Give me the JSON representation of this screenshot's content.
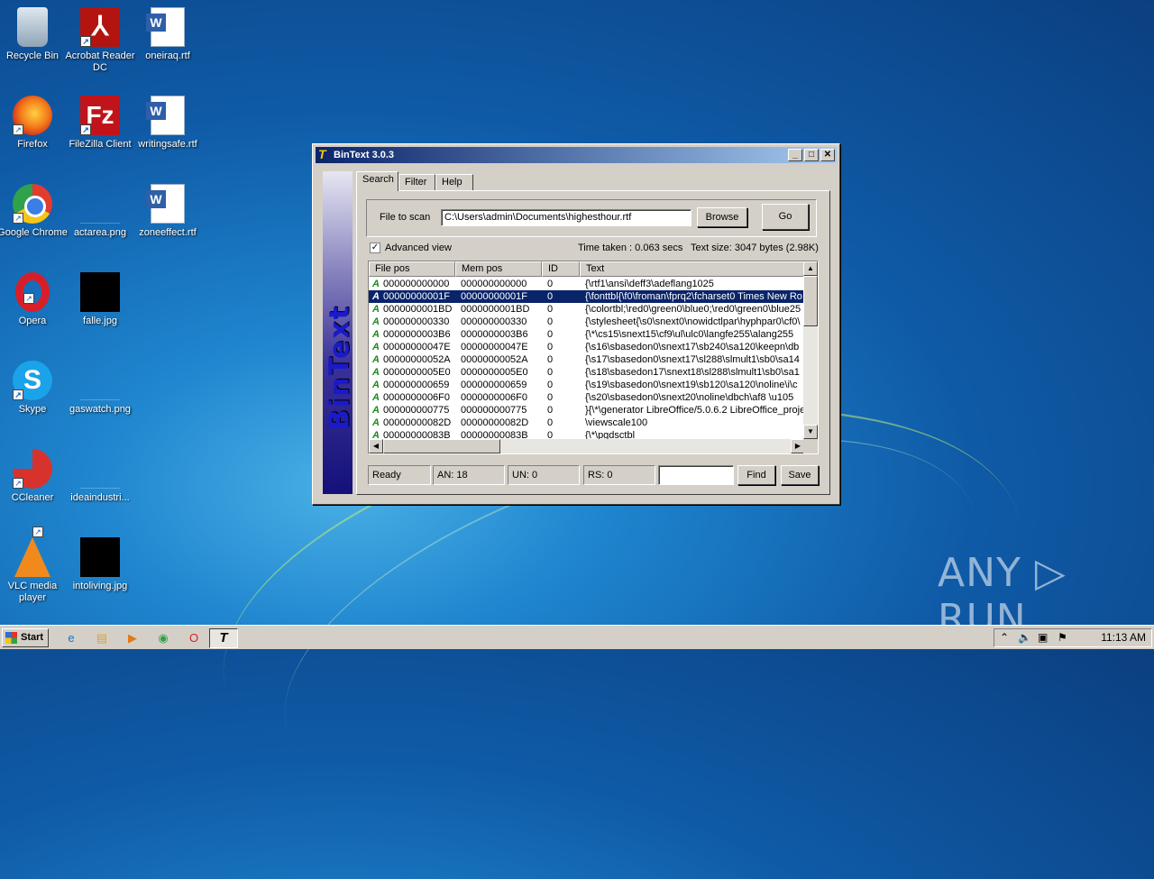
{
  "desktop": {
    "icons": [
      {
        "label": "Recycle Bin",
        "icon": "recycle-bin-icon"
      },
      {
        "label": "Acrobat Reader DC",
        "icon": "acrobat-icon"
      },
      {
        "label": "oneiraq.rtf",
        "icon": "word-document-icon"
      },
      {
        "label": "Firefox",
        "icon": "firefox-icon"
      },
      {
        "label": "FileZilla Client",
        "icon": "filezilla-icon"
      },
      {
        "label": "writingsafe.rtf",
        "icon": "word-document-icon"
      },
      {
        "label": "Google Chrome",
        "icon": "chrome-icon"
      },
      {
        "label": "actarea.png",
        "icon": "image-file-icon"
      },
      {
        "label": "zoneeffect.rtf",
        "icon": "word-document-icon"
      },
      {
        "label": "Opera",
        "icon": "opera-icon"
      },
      {
        "label": "falle.jpg",
        "icon": "image-thumbnail-icon"
      },
      {
        "label": "Skype",
        "icon": "skype-icon"
      },
      {
        "label": "gaswatch.png",
        "icon": "image-file-icon"
      },
      {
        "label": "CCleaner",
        "icon": "ccleaner-icon"
      },
      {
        "label": "ideaindustri...",
        "icon": "image-file-icon"
      },
      {
        "label": "VLC media player",
        "icon": "vlc-icon"
      },
      {
        "label": "intoliving.jpg",
        "icon": "image-thumbnail-icon"
      }
    ]
  },
  "window": {
    "title": "BinText 3.0.3",
    "title_icon_glyph": "T",
    "controls": {
      "minimize": "_",
      "maximize": "□",
      "close": "✕"
    },
    "banner_text": "BinText",
    "tabs": [
      "Search",
      "Filter",
      "Help"
    ],
    "active_tab": "Search",
    "file_label": "File to scan",
    "file_value": "C:\\Users\\admin\\Documents\\highesthour.rtf",
    "browse_label": "Browse",
    "go_label": "Go",
    "advanced_view_label": "Advanced view",
    "advanced_view_checked": "✓",
    "time_taken": "Time taken : 0.063 secs",
    "text_size": "Text size: 3047 bytes (2.98K)",
    "columns": [
      "File pos",
      "Mem pos",
      "ID",
      "Text"
    ],
    "rows": [
      {
        "type": "A",
        "file_pos": "000000000000",
        "mem_pos": "000000000000",
        "id": "0",
        "text": "{\\rtf1\\ansi\\deff3\\adeflang1025"
      },
      {
        "type": "A",
        "file_pos": "00000000001F",
        "mem_pos": "00000000001F",
        "id": "0",
        "text": "{\\fonttbl{\\f0\\froman\\fprq2\\fcharset0 Times New Ro"
      },
      {
        "type": "A",
        "file_pos": "0000000001BD",
        "mem_pos": "0000000001BD",
        "id": "0",
        "text": "{\\colortbl;\\red0\\green0\\blue0;\\red0\\green0\\blue25"
      },
      {
        "type": "A",
        "file_pos": "000000000330",
        "mem_pos": "000000000330",
        "id": "0",
        "text": "{\\stylesheet{\\s0\\snext0\\nowidctlpar\\hyphpar0\\cf0\\"
      },
      {
        "type": "A",
        "file_pos": "0000000003B6",
        "mem_pos": "0000000003B6",
        "id": "0",
        "text": "{\\*\\cs15\\snext15\\cf9\\ul\\ulc0\\langfe255\\alang255"
      },
      {
        "type": "A",
        "file_pos": "00000000047E",
        "mem_pos": "00000000047E",
        "id": "0",
        "text": "{\\s16\\sbasedon0\\snext17\\sb240\\sa120\\keepn\\db"
      },
      {
        "type": "A",
        "file_pos": "00000000052A",
        "mem_pos": "00000000052A",
        "id": "0",
        "text": "{\\s17\\sbasedon0\\snext17\\sl288\\slmult1\\sb0\\sa14"
      },
      {
        "type": "A",
        "file_pos": "0000000005E0",
        "mem_pos": "0000000005E0",
        "id": "0",
        "text": "{\\s18\\sbasedon17\\snext18\\sl288\\slmult1\\sb0\\sa1"
      },
      {
        "type": "A",
        "file_pos": "000000000659",
        "mem_pos": "000000000659",
        "id": "0",
        "text": "{\\s19\\sbasedon0\\snext19\\sb120\\sa120\\noline\\i\\c"
      },
      {
        "type": "A",
        "file_pos": "0000000006F0",
        "mem_pos": "0000000006F0",
        "id": "0",
        "text": "{\\s20\\sbasedon0\\snext20\\noline\\dbch\\af8 \\u105"
      },
      {
        "type": "A",
        "file_pos": "000000000775",
        "mem_pos": "000000000775",
        "id": "0",
        "text": "}{\\*\\generator LibreOffice/5.0.6.2 LibreOffice_proje"
      },
      {
        "type": "A",
        "file_pos": "00000000082D",
        "mem_pos": "00000000082D",
        "id": "0",
        "text": "\\viewscale100"
      },
      {
        "type": "A",
        "file_pos": "00000000083B",
        "mem_pos": "00000000083B",
        "id": "0",
        "text": "{\\*\\pgdsctbl"
      }
    ],
    "status": {
      "ready": "Ready",
      "an": "AN: 18",
      "un": "UN: 0",
      "rs": "RS: 0",
      "find_value": ""
    },
    "find_label": "Find",
    "save_label": "Save"
  },
  "taskbar": {
    "start_label": "Start",
    "pinned": [
      "internet-explorer-icon",
      "explorer-icon",
      "media-player-icon",
      "chrome-icon",
      "opera-icon"
    ],
    "active_task_glyph": "T",
    "clock": "11:13 AM"
  },
  "watermark": "ANY ▷ RUN"
}
